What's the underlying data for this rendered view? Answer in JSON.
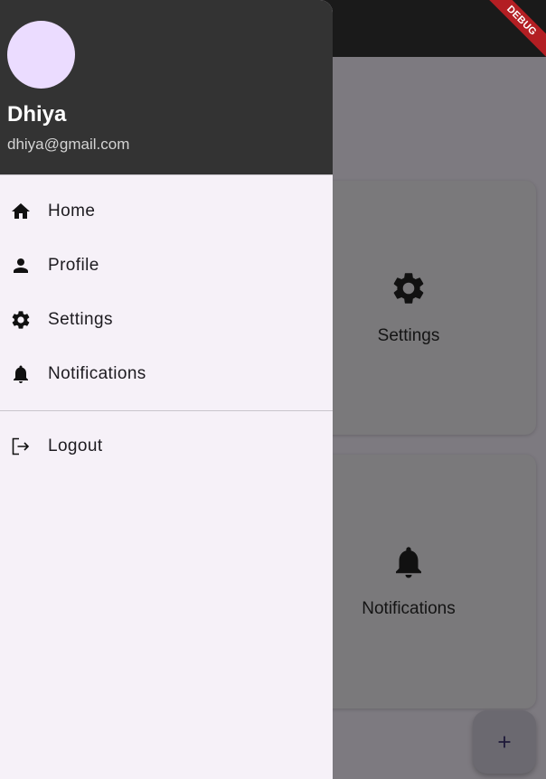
{
  "background_app": {
    "cards": [
      {
        "label": "Settings",
        "icon": "gear-icon"
      },
      {
        "label": "Notifications",
        "icon": "bell-icon"
      }
    ],
    "fab_icon": "plus-icon",
    "debug_banner": "DEBUG"
  },
  "drawer": {
    "account": {
      "name": "Dhiya",
      "email": "dhiya@gmail.com",
      "avatar_color": "#ebdcff"
    },
    "items": [
      {
        "label": "Home",
        "icon": "home-icon"
      },
      {
        "label": "Profile",
        "icon": "person-icon"
      },
      {
        "label": "Settings",
        "icon": "gear-icon"
      },
      {
        "label": "Notifications",
        "icon": "bell-icon"
      }
    ],
    "logout": {
      "label": "Logout",
      "icon": "logout-icon"
    }
  },
  "colors": {
    "drawer_header": "#333333",
    "drawer_bg": "#f6f1f8",
    "scrim": "#7d7a80"
  }
}
